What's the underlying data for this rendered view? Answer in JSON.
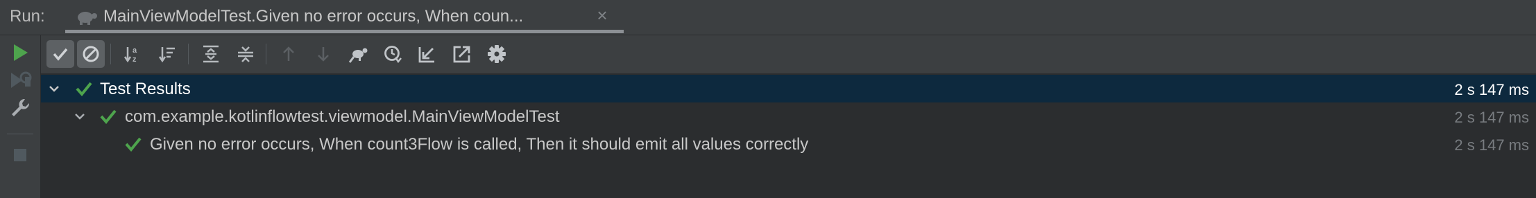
{
  "header": {
    "run_label": "Run:",
    "tab_title": "MainViewModelTest.Given no error occurs, When coun...",
    "tab_close": "×"
  },
  "tree": {
    "root": {
      "label": "Test Results",
      "time": "2 s 147 ms"
    },
    "suite": {
      "label": "com.example.kotlinflowtest.viewmodel.MainViewModelTest",
      "time": "2 s 147 ms"
    },
    "test": {
      "label": "Given no error occurs, When count3Flow is called, Then it should emit all values correctly",
      "time": "2 s 147 ms"
    }
  },
  "icons": {
    "tab": "turtle-icon",
    "side": [
      "run-icon",
      "rerun-failed-icon",
      "wrench-icon",
      "stop-icon"
    ],
    "toolbar": [
      "show-passed-icon",
      "show-ignored-icon",
      "sort-alphabetically-icon",
      "sort-by-duration-icon",
      "expand-all-icon",
      "collapse-all-icon",
      "previous-failed-icon",
      "next-failed-icon",
      "turtle-icon",
      "history-icon",
      "import-tests-icon",
      "export-tests-icon",
      "settings-gear-icon"
    ]
  },
  "colors": {
    "accent_green": "#4ea44d",
    "selection": "#0d293e",
    "panel": "#3c3f41",
    "background": "#2b2d2f"
  }
}
